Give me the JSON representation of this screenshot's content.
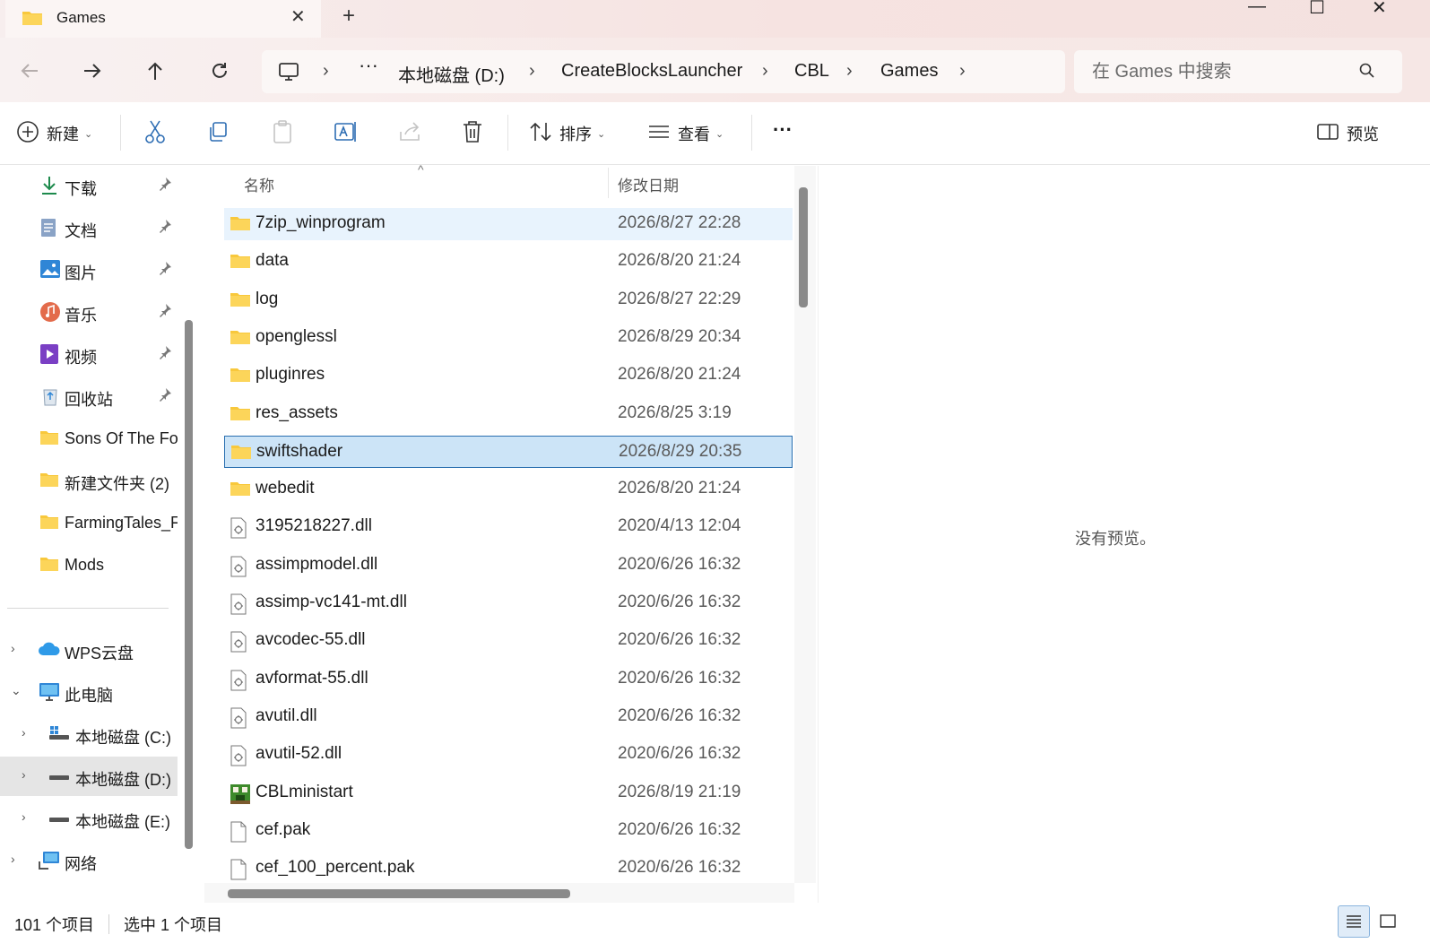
{
  "tab": {
    "title": "Games",
    "close": "✕",
    "add": "+"
  },
  "window_controls": {
    "minimize": "—",
    "maximize": "☐",
    "close": "✕"
  },
  "breadcrumb": {
    "more": "···",
    "items": [
      "本地磁盘 (D:)",
      "CreateBlocksLauncher",
      "CBL",
      "Games"
    ]
  },
  "search": {
    "placeholder": "在 Games 中搜索"
  },
  "toolbar": {
    "new_label": "新建",
    "sort_label": "排序",
    "view_label": "查看",
    "more_label": "···",
    "preview_label": "预览"
  },
  "sidebar": {
    "quick_access": [
      {
        "label": "下载",
        "icon": "download-icon"
      },
      {
        "label": "文档",
        "icon": "document-icon"
      },
      {
        "label": "图片",
        "icon": "pictures-icon"
      },
      {
        "label": "音乐",
        "icon": "music-icon"
      },
      {
        "label": "视频",
        "icon": "video-icon"
      },
      {
        "label": "回收站",
        "icon": "recycle-bin-icon"
      },
      {
        "label": "Sons Of The Fo",
        "icon": "folder-icon"
      },
      {
        "label": "新建文件夹 (2)",
        "icon": "folder-icon"
      },
      {
        "label": "FarmingTales_F",
        "icon": "folder-icon"
      },
      {
        "label": "Mods",
        "icon": "folder-icon"
      }
    ],
    "tree": [
      {
        "label": "WPS云盘",
        "icon": "cloud-icon"
      },
      {
        "label": "此电脑",
        "icon": "computer-icon"
      },
      {
        "label": "本地磁盘 (C:)",
        "icon": "drive-c-icon"
      },
      {
        "label": "本地磁盘 (D:)",
        "icon": "drive-icon"
      },
      {
        "label": "本地磁盘 (E:)",
        "icon": "drive-icon"
      },
      {
        "label": "网络",
        "icon": "network-icon"
      }
    ]
  },
  "file_list": {
    "columns": {
      "name": "名称",
      "date": "修改日期"
    },
    "rows": [
      {
        "name": "7zip_winprogram",
        "date": "2026/8/27 22:28",
        "type": "folder",
        "state": "hover"
      },
      {
        "name": "data",
        "date": "2026/8/20 21:24",
        "type": "folder",
        "state": ""
      },
      {
        "name": "log",
        "date": "2026/8/27 22:29",
        "type": "folder",
        "state": ""
      },
      {
        "name": "openglessl",
        "date": "2026/8/29 20:34",
        "type": "folder",
        "state": ""
      },
      {
        "name": "pluginres",
        "date": "2026/8/20 21:24",
        "type": "folder",
        "state": ""
      },
      {
        "name": "res_assets",
        "date": "2026/8/25 3:19",
        "type": "folder",
        "state": ""
      },
      {
        "name": "swiftshader",
        "date": "2026/8/29 20:35",
        "type": "folder",
        "state": "selected"
      },
      {
        "name": "webedit",
        "date": "2026/8/20 21:24",
        "type": "folder",
        "state": ""
      },
      {
        "name": "3195218227.dll",
        "date": "2020/4/13 12:04",
        "type": "dll",
        "state": ""
      },
      {
        "name": "assimpmodel.dll",
        "date": "2020/6/26 16:32",
        "type": "dll",
        "state": ""
      },
      {
        "name": "assimp-vc141-mt.dll",
        "date": "2020/6/26 16:32",
        "type": "dll",
        "state": ""
      },
      {
        "name": "avcodec-55.dll",
        "date": "2020/6/26 16:32",
        "type": "dll",
        "state": ""
      },
      {
        "name": "avformat-55.dll",
        "date": "2020/6/26 16:32",
        "type": "dll",
        "state": ""
      },
      {
        "name": "avutil.dll",
        "date": "2020/6/26 16:32",
        "type": "dll",
        "state": ""
      },
      {
        "name": "avutil-52.dll",
        "date": "2020/6/26 16:32",
        "type": "dll",
        "state": ""
      },
      {
        "name": "CBLministart",
        "date": "2026/8/19 21:19",
        "type": "exe",
        "state": ""
      },
      {
        "name": "cef.pak",
        "date": "2020/6/26 16:32",
        "type": "file",
        "state": ""
      },
      {
        "name": "cef_100_percent.pak",
        "date": "2020/6/26 16:32",
        "type": "file",
        "state": ""
      }
    ]
  },
  "preview_pane": {
    "message": "没有预览。"
  },
  "status": {
    "item_count": "101 个项目",
    "selection": "选中 1 个项目"
  },
  "colors": {
    "accent": "#2a6fb0",
    "selected_row": "#cce4f7",
    "hover_row": "#e8f3fd",
    "folder": "#f8c83c"
  }
}
